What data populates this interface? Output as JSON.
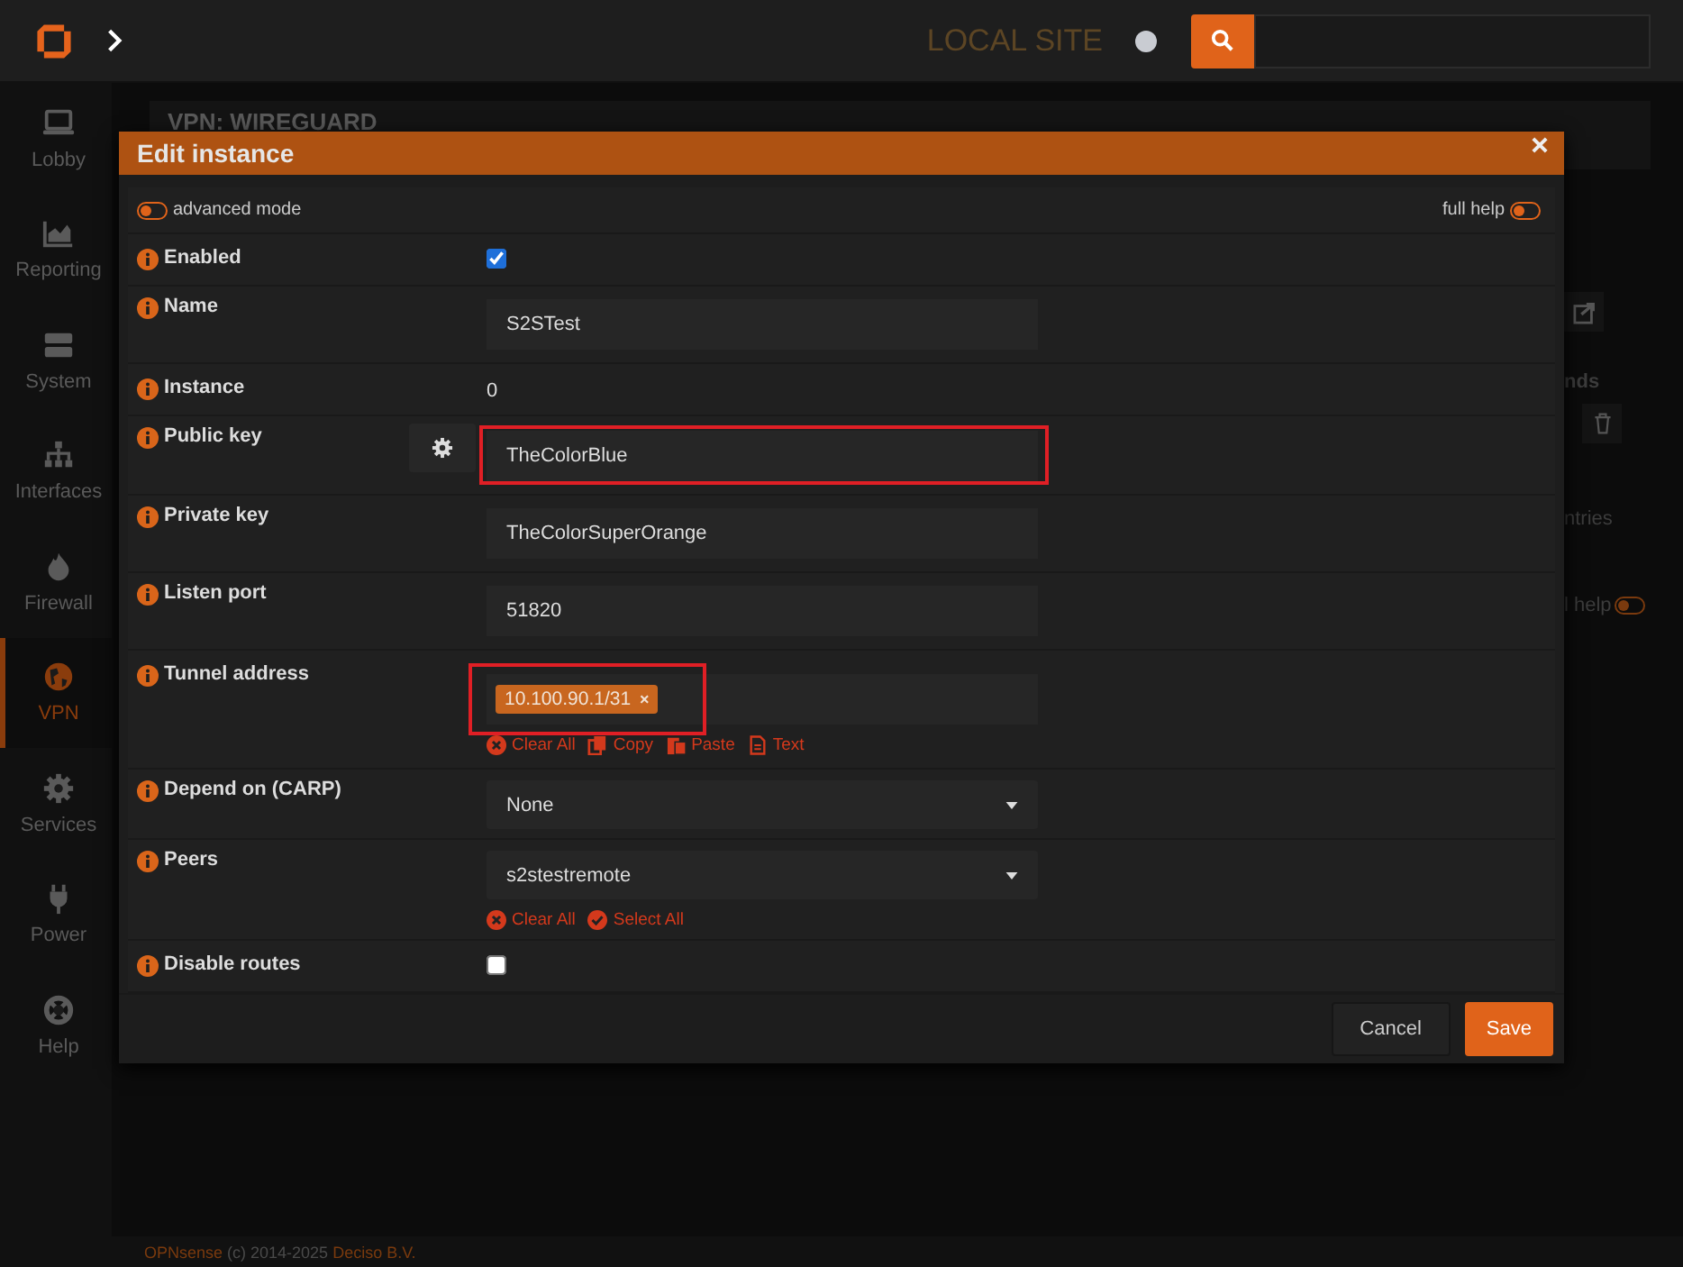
{
  "topbar": {
    "site": "LOCAL SITE"
  },
  "sidebar": {
    "items": [
      {
        "label": "Lobby",
        "selected": false
      },
      {
        "label": "Reporting",
        "selected": false
      },
      {
        "label": "System",
        "selected": false
      },
      {
        "label": "Interfaces",
        "selected": false
      },
      {
        "label": "Firewall",
        "selected": false
      },
      {
        "label": "VPN",
        "selected": true
      },
      {
        "label": "Services",
        "selected": false
      },
      {
        "label": "Power",
        "selected": false
      },
      {
        "label": "Help",
        "selected": false
      }
    ]
  },
  "page": {
    "title": "VPN: WIREGUARD",
    "fragment_heading": "nds",
    "fragment_entries": "ntries",
    "fragment_help": "l help",
    "help_toggle_on": false
  },
  "dialog": {
    "title": "Edit instance",
    "advanced_mode": {
      "label": "advanced mode",
      "on": false
    },
    "full_help": {
      "label": "full help",
      "on": false
    },
    "fields": [
      {
        "kind": "checkbox",
        "label": "Enabled",
        "checked": true
      },
      {
        "kind": "text",
        "label": "Name",
        "value": "S2STest",
        "highlighted": false
      },
      {
        "kind": "static",
        "label": "Instance",
        "value": "0"
      },
      {
        "kind": "text",
        "label": "Public key",
        "value": "TheColorBlue",
        "highlighted": true,
        "generate_button": true
      },
      {
        "kind": "text",
        "label": "Private key",
        "value": "TheColorSuperOrange",
        "highlighted": false
      },
      {
        "kind": "text",
        "label": "Listen port",
        "value": "51820",
        "highlighted": false
      },
      {
        "kind": "tokens",
        "label": "Tunnel address",
        "tokens": [
          "10.100.90.1/31"
        ],
        "remove_mark": "×",
        "highlighted": true,
        "actions": [
          {
            "kind": "clear",
            "label": "Clear All"
          },
          {
            "kind": "copy",
            "label": "Copy"
          },
          {
            "kind": "paste",
            "label": "Paste"
          },
          {
            "kind": "text",
            "label": "Text"
          }
        ]
      },
      {
        "kind": "select",
        "label": "Depend on (CARP)",
        "value": "None"
      },
      {
        "kind": "select",
        "label": "Peers",
        "value": "s2stestremote",
        "actions": [
          {
            "kind": "clear",
            "label": "Clear All"
          },
          {
            "kind": "select",
            "label": "Select All"
          }
        ]
      },
      {
        "kind": "checkbox",
        "label": "Disable routes",
        "checked": false
      }
    ],
    "buttons": [
      {
        "label": "Cancel",
        "kind": "default"
      },
      {
        "label": "Save",
        "kind": "primary"
      }
    ]
  },
  "footer": {
    "brand": "OPNsense",
    "text": "(c) 2014-2025",
    "company": "Deciso B.V."
  }
}
